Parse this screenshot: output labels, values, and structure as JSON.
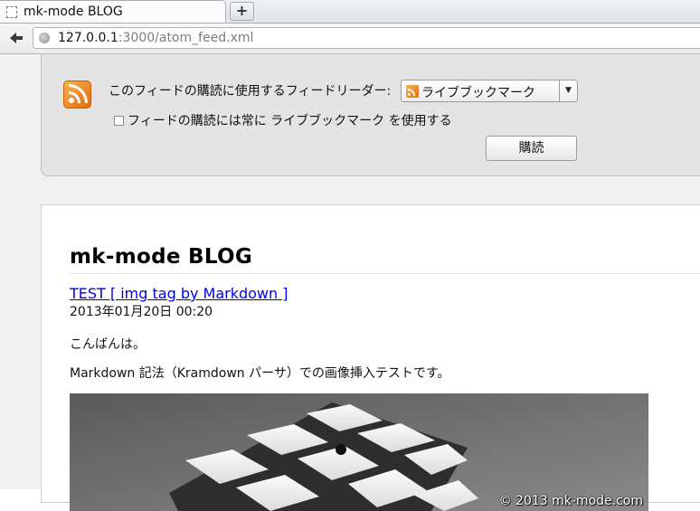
{
  "browser": {
    "tab_title": "mk-mode BLOG",
    "new_tab_symbol": "+",
    "url_host": "127.0.0.1",
    "url_rest": ":3000/atom_feed.xml"
  },
  "feed_header": {
    "reader_label": "このフィードの購読に使用するフィードリーダー:",
    "reader_selected": "ライブブックマーク",
    "always_use_label": "フィードの購読には常に ライブブックマーク を使用する",
    "always_use_checked": false,
    "subscribe_button": "購読"
  },
  "feed": {
    "title": "mk-mode BLOG",
    "entry": {
      "title_link": "TEST [ img tag by Markdown ]",
      "date": "2013年01月20日 00:20",
      "paragraph1": "こんばんは。",
      "paragraph2": "Markdown 記法（Kramdown パーサ）での画像挿入テストです。",
      "image_watermark": "© 2013 mk-mode.com"
    }
  },
  "colors": {
    "rss_orange": "#e46b0f",
    "link_blue": "#0000ee"
  },
  "icons": {
    "page": "page-icon",
    "back": "back-arrow-icon",
    "globe": "globe-icon",
    "rss": "rss-feed-icon",
    "dropdown": "chevron-down-icon"
  }
}
